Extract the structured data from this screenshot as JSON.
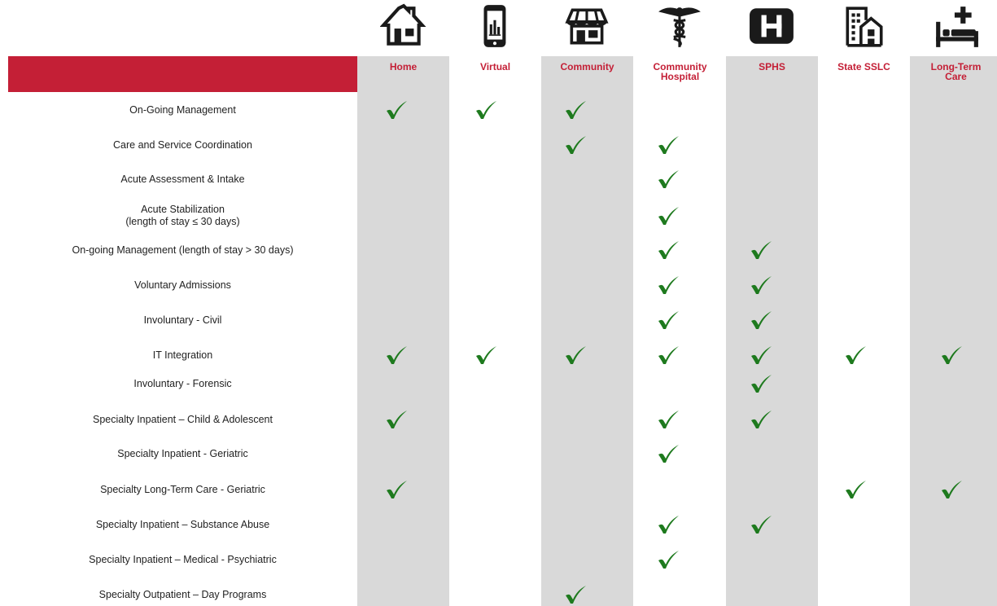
{
  "columns": [
    {
      "key": "home",
      "label": "Home",
      "icon": "house-icon"
    },
    {
      "key": "virtual",
      "label": "Virtual",
      "icon": "smartphone-chart-icon"
    },
    {
      "key": "community",
      "label": "Community",
      "icon": "storefront-icon"
    },
    {
      "key": "community_hospital",
      "label": "Community\nHospital",
      "icon": "caduceus-icon"
    },
    {
      "key": "sphs",
      "label": "SPHS",
      "icon": "hospital-h-icon"
    },
    {
      "key": "state_sslc",
      "label": "State SSLC",
      "icon": "building-icon"
    },
    {
      "key": "long_term_care",
      "label": "Long-Term\nCare",
      "icon": "hospital-bed-icon"
    }
  ],
  "rows": [
    {
      "label": "On-Going Management",
      "checks": [
        "home",
        "virtual",
        "community"
      ]
    },
    {
      "label": "Care and Service Coordination",
      "checks": [
        "community",
        "community_hospital"
      ]
    },
    {
      "label": "Acute Assessment & Intake",
      "checks": [
        "community_hospital"
      ]
    },
    {
      "label": "Acute Stabilization\n(length of stay ≤ 30 days)",
      "checks": [
        "community_hospital"
      ]
    },
    {
      "label": "On-going Management (length of stay > 30 days)",
      "checks": [
        "community_hospital",
        "sphs"
      ]
    },
    {
      "label": "Voluntary Admissions",
      "checks": [
        "community_hospital",
        "sphs"
      ]
    },
    {
      "label": "Involuntary - Civil",
      "checks": [
        "community_hospital",
        "sphs"
      ]
    },
    {
      "label": "IT Integration",
      "checks": [
        "home",
        "virtual",
        "community",
        "community_hospital",
        "sphs",
        "state_sslc",
        "long_term_care"
      ]
    },
    {
      "label": "Involuntary - Forensic",
      "checks": [
        "sphs"
      ]
    },
    {
      "label": "Specialty Inpatient – Child & Adolescent",
      "checks": [
        "home",
        "community_hospital",
        "sphs"
      ]
    },
    {
      "label": "Specialty Inpatient - Geriatric",
      "checks": [
        "community_hospital"
      ]
    },
    {
      "label": "Specialty Long-Term Care - Geriatric",
      "checks": [
        "home",
        "state_sslc",
        "long_term_care"
      ]
    },
    {
      "label": "Specialty Inpatient – Substance Abuse",
      "checks": [
        "community_hospital",
        "sphs"
      ]
    },
    {
      "label": "Specialty Inpatient – Medical - Psychiatric",
      "checks": [
        "community_hospital"
      ]
    },
    {
      "label": "Specialty Outpatient – Day Programs",
      "checks": [
        "community"
      ]
    }
  ],
  "colors": {
    "accent_red": "#c41f36",
    "band_gray": "#d9d9d9",
    "check_green": "#1e7a1e",
    "icon_dark": "#1a1a1a"
  }
}
